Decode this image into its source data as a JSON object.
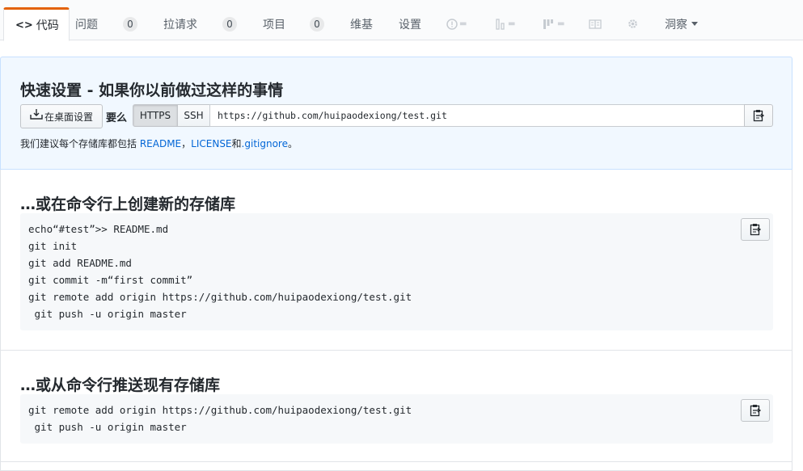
{
  "tabs": [
    {
      "label": "代码",
      "icon": "code-icon",
      "selected": true
    },
    {
      "label": "问题",
      "count": "0"
    },
    {
      "label": "拉请求",
      "count": "0"
    },
    {
      "label": "项目",
      "count": "0"
    },
    {
      "label": "维基"
    },
    {
      "label": "设置"
    },
    {
      "label": "洞察"
    }
  ],
  "quick_setup": {
    "title": "快速设置 - 如果你以前做过这样的事情",
    "desktop_button": "在桌面设置",
    "or_label": "要么",
    "https_label": "HTTPS",
    "ssh_label": "SSH",
    "clone_url": "https://github.com/huipaodexiong/test.git",
    "hint_prefix": "我们建议每个存储库都包括 ",
    "hint_readme": "README",
    "hint_sep": "，",
    "hint_license": "LICENSE",
    "hint_and": "和",
    "hint_gitignore": ".gitignore",
    "hint_end": "。"
  },
  "create_section": {
    "title": "…或在命令行上创建新的存储库",
    "lines": [
      "echo“#test”>> README.md",
      "git init",
      "git add README.md",
      "git commit -m“first commit”",
      "git remote add origin https://github.com/huipaodexiong/test.git",
      " git push -u origin master"
    ]
  },
  "push_section": {
    "title": "…或从命令行推送现有存储库",
    "lines": [
      "git remote add origin https://github.com/huipaodexiong/test.git",
      " git push -u origin master"
    ]
  },
  "colors": {
    "accent_tab": "#e36209",
    "link": "#0366d6",
    "quick_bg": "#f1f8ff",
    "code_bg": "#f6f8fa"
  }
}
